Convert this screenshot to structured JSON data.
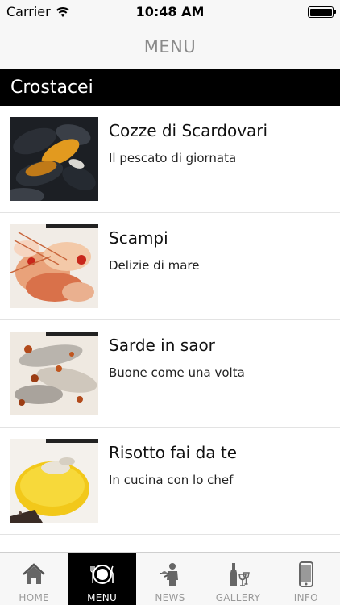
{
  "status_bar": {
    "carrier": "Carrier",
    "time": "10:48 AM",
    "wifi_icon": "wifi-icon",
    "battery_icon": "battery-icon"
  },
  "nav": {
    "title": "MENU"
  },
  "section": {
    "title": "Crostacei"
  },
  "items": [
    {
      "title": "Cozze di Scardovari",
      "subtitle": "Il pescato di giornata",
      "image": "mussels-photo"
    },
    {
      "title": "Scampi",
      "subtitle": "Delizie di mare",
      "image": "scampi-photo"
    },
    {
      "title": "Sarde in saor",
      "subtitle": "Buone come una volta",
      "image": "sardines-photo"
    },
    {
      "title": "Risotto fai da te",
      "subtitle": "In cucina con lo chef",
      "image": "risotto-photo"
    }
  ],
  "tabs": [
    {
      "label": "HOME",
      "icon": "home-icon",
      "active": false
    },
    {
      "label": "MENU",
      "icon": "plate-icon",
      "active": true
    },
    {
      "label": "NEWS",
      "icon": "waiter-icon",
      "active": false
    },
    {
      "label": "GALLERY",
      "icon": "wine-bottle-icon",
      "active": false
    },
    {
      "label": "INFO",
      "icon": "phone-icon",
      "active": false
    }
  ],
  "colors": {
    "header_bg": "#f7f7f7",
    "section_bg": "#000000",
    "active_tab_bg": "#000000",
    "inactive_tab_text": "#9a9a9a"
  }
}
